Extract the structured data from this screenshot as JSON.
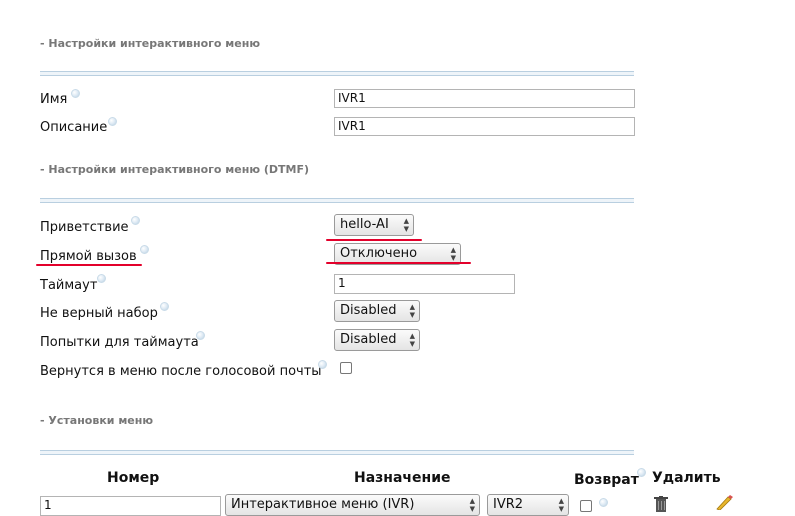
{
  "sections": {
    "ivr_settings": "- Настройки интерактивного меню",
    "dtmf_settings": "- Настройки интерактивного меню (DTMF)",
    "menu_settings": "- Установки меню"
  },
  "fields": {
    "name": {
      "label": "Имя",
      "value": "IVR1"
    },
    "description": {
      "label": "Описание",
      "value": "IVR1"
    },
    "greeting": {
      "label": "Приветствие",
      "value": "hello-AI"
    },
    "direct_dial": {
      "label": "Прямой вызов",
      "value": "Отключено"
    },
    "timeout": {
      "label": "Таймаут",
      "value": "1"
    },
    "invalid_input": {
      "label": "Не верный набор",
      "value": "Disabled"
    },
    "timeout_attempts": {
      "label": "Попытки для таймаута",
      "value": "Disabled"
    },
    "return_after_vm": {
      "label": "Вернутся в меню после голосовой почты",
      "checked": false
    }
  },
  "table": {
    "headers": {
      "number": "Номер",
      "destination": "Назначение",
      "return": "Возврат",
      "delete": "Удалить"
    },
    "rows": [
      {
        "number": "1",
        "destination_type": "Интерактивное меню (IVR)",
        "destination_value": "IVR2",
        "return": false
      }
    ]
  },
  "colors": {
    "annotation": "#e3002b",
    "rule": "#b9cfe0"
  },
  "icons": [
    "help-icon",
    "trash-icon",
    "pencil-icon",
    "select-arrows-icon"
  ]
}
